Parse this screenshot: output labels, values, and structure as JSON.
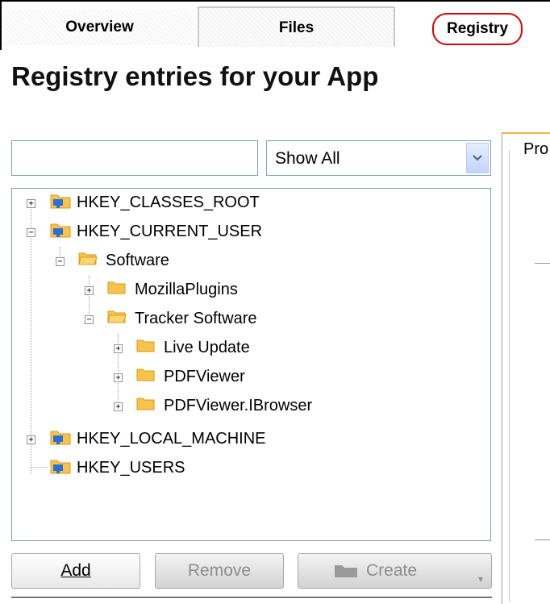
{
  "tabs": [
    {
      "label": "Overview"
    },
    {
      "label": "Files"
    },
    {
      "label": "Registry"
    }
  ],
  "page_title": "Registry entries for your App",
  "search": {
    "value": "",
    "placeholder": ""
  },
  "filter": {
    "value": "Show All"
  },
  "side_panel": {
    "tab_label": "Pro"
  },
  "tree": [
    {
      "label": "HKEY_CLASSES_ROOT",
      "type": "hive",
      "expanded": false
    },
    {
      "label": "HKEY_CURRENT_USER",
      "type": "hive",
      "expanded": true
    },
    {
      "label": "Software",
      "type": "folder",
      "expanded": true
    },
    {
      "label": "MozillaPlugins",
      "type": "folder",
      "expanded": false
    },
    {
      "label": "Tracker Software",
      "type": "folder",
      "expanded": true
    },
    {
      "label": "Live Update",
      "type": "folder",
      "expanded": false
    },
    {
      "label": "PDFViewer",
      "type": "folder",
      "expanded": false
    },
    {
      "label": "PDFViewer.IBrowser",
      "type": "folder",
      "expanded": false
    },
    {
      "label": "HKEY_LOCAL_MACHINE",
      "type": "hive",
      "expanded": false
    },
    {
      "label": "HKEY_USERS",
      "type": "hive",
      "expanded": null
    }
  ],
  "buttons": {
    "add": "Add",
    "remove": "Remove",
    "create": "Create"
  },
  "colors": {
    "folder": "#f7c34c",
    "folder_dark": "#d99a1a",
    "network": "#2a6fd6",
    "accent_red": "#e00000"
  },
  "icons": {
    "hive": "registry-hive-icon",
    "folder": "folder-icon"
  }
}
